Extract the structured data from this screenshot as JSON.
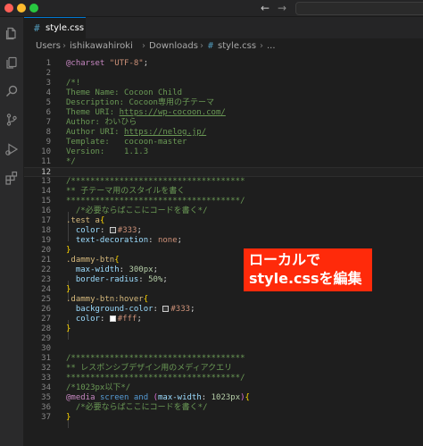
{
  "window": {
    "nav_back": "←",
    "nav_forward": "→"
  },
  "activity_bar": {
    "icons": [
      "explorer-icon",
      "copy-icon",
      "search-icon",
      "source-control-icon",
      "run-debug-icon",
      "extensions-icon"
    ]
  },
  "tab": {
    "icon": "#",
    "label": "style.css",
    "icon_color": "#519aba"
  },
  "breadcrumb": {
    "parts": [
      "Users",
      "ishikawahiroki",
      "Downloads"
    ],
    "file_icon": "#",
    "file": "style.css",
    "trail": "..."
  },
  "editor": {
    "current_line": 12,
    "lines": [
      {
        "n": "1",
        "tokens": [
          {
            "t": "@charset",
            "c": "at"
          },
          {
            "t": " "
          },
          {
            "t": "\"UTF-8\"",
            "c": "str"
          },
          {
            "t": ";",
            "c": "punc"
          }
        ]
      },
      {
        "n": "2",
        "tokens": []
      },
      {
        "n": "3",
        "tokens": [
          {
            "t": "/*!",
            "c": "com"
          }
        ]
      },
      {
        "n": "4",
        "tokens": [
          {
            "t": "Theme Name: Cocoon Child",
            "c": "com"
          }
        ]
      },
      {
        "n": "5",
        "tokens": [
          {
            "t": "Description: Cocoon専用の子テーマ",
            "c": "com"
          }
        ]
      },
      {
        "n": "6",
        "tokens": [
          {
            "t": "Theme URI: ",
            "c": "com"
          },
          {
            "t": "https://wp-cocoon.com/",
            "c": "link"
          }
        ]
      },
      {
        "n": "7",
        "tokens": [
          {
            "t": "Author: わいひら",
            "c": "com"
          }
        ]
      },
      {
        "n": "8",
        "tokens": [
          {
            "t": "Author URI: ",
            "c": "com"
          },
          {
            "t": "https://nelog.jp/",
            "c": "link"
          }
        ]
      },
      {
        "n": "9",
        "tokens": [
          {
            "t": "Template:   cocoon-master",
            "c": "com"
          }
        ]
      },
      {
        "n": "10",
        "tokens": [
          {
            "t": "Version:    1.1.3",
            "c": "com"
          }
        ]
      },
      {
        "n": "11",
        "tokens": [
          {
            "t": "*/",
            "c": "com"
          }
        ]
      },
      {
        "n": "12",
        "tokens": []
      },
      {
        "n": "13",
        "tokens": [
          {
            "t": "/************************************",
            "c": "com"
          }
        ]
      },
      {
        "n": "14",
        "tokens": [
          {
            "t": "** 子テーマ用のスタイルを書く",
            "c": "com"
          }
        ]
      },
      {
        "n": "15",
        "tokens": [
          {
            "t": "************************************/",
            "c": "com"
          }
        ]
      },
      {
        "n": "16",
        "tokens": [
          {
            "t": "  "
          },
          {
            "t": "/*必要ならばここにコードを書く*/",
            "c": "com"
          }
        ]
      },
      {
        "n": "17",
        "tokens": [
          {
            "t": ".test a",
            "c": "sel"
          },
          {
            "t": "{",
            "c": "brace"
          }
        ]
      },
      {
        "n": "18",
        "tokens": [
          {
            "t": "  "
          },
          {
            "t": "color",
            "c": "prop"
          },
          {
            "t": ": ",
            "c": "punc"
          },
          {
            "sw": "#333333"
          },
          {
            "t": "#333",
            "c": "val"
          },
          {
            "t": ";",
            "c": "punc"
          }
        ]
      },
      {
        "n": "19",
        "tokens": [
          {
            "t": "  "
          },
          {
            "t": "text-decoration",
            "c": "prop"
          },
          {
            "t": ": ",
            "c": "punc"
          },
          {
            "t": "none",
            "c": "val"
          },
          {
            "t": ";",
            "c": "punc"
          }
        ]
      },
      {
        "n": "20",
        "tokens": [
          {
            "t": "}",
            "c": "brace"
          }
        ]
      },
      {
        "n": "21",
        "tokens": [
          {
            "t": ".dammy-btn",
            "c": "sel"
          },
          {
            "t": "{",
            "c": "brace"
          }
        ]
      },
      {
        "n": "22",
        "tokens": [
          {
            "t": "  "
          },
          {
            "t": "max-width",
            "c": "prop"
          },
          {
            "t": ": ",
            "c": "punc"
          },
          {
            "t": "300px",
            "c": "num"
          },
          {
            "t": ";",
            "c": "punc"
          }
        ]
      },
      {
        "n": "23",
        "tokens": [
          {
            "t": "  "
          },
          {
            "t": "border-radius",
            "c": "prop"
          },
          {
            "t": ": ",
            "c": "punc"
          },
          {
            "t": "50%",
            "c": "num"
          },
          {
            "t": ";",
            "c": "punc"
          }
        ]
      },
      {
        "n": "24",
        "tokens": [
          {
            "t": "}",
            "c": "brace"
          }
        ]
      },
      {
        "n": "25",
        "tokens": [
          {
            "t": ".dammy-btn:hover",
            "c": "sel"
          },
          {
            "t": "{",
            "c": "brace"
          }
        ]
      },
      {
        "n": "26",
        "tokens": [
          {
            "t": "  "
          },
          {
            "t": "background-color",
            "c": "prop"
          },
          {
            "t": ": ",
            "c": "punc"
          },
          {
            "sw": "#333333"
          },
          {
            "t": "#333",
            "c": "val"
          },
          {
            "t": ";",
            "c": "punc"
          }
        ]
      },
      {
        "n": "27",
        "tokens": [
          {
            "t": "  "
          },
          {
            "t": "color",
            "c": "prop"
          },
          {
            "t": ": ",
            "c": "punc"
          },
          {
            "sw": "#ffffff"
          },
          {
            "t": "#fff",
            "c": "val"
          },
          {
            "t": ";",
            "c": "punc"
          }
        ]
      },
      {
        "n": "28",
        "tokens": [
          {
            "t": "}",
            "c": "brace"
          }
        ]
      },
      {
        "n": "29",
        "tokens": []
      },
      {
        "n": "30",
        "tokens": []
      },
      {
        "n": "31",
        "tokens": [
          {
            "t": "/************************************",
            "c": "com"
          }
        ]
      },
      {
        "n": "32",
        "tokens": [
          {
            "t": "** レスポンシブデザイン用のメディアクエリ",
            "c": "com"
          }
        ]
      },
      {
        "n": "33",
        "tokens": [
          {
            "t": "************************************/",
            "c": "com"
          }
        ]
      },
      {
        "n": "34",
        "tokens": [
          {
            "t": "/*1023px以下*/",
            "c": "com"
          }
        ]
      },
      {
        "n": "35",
        "tokens": [
          {
            "t": "@media",
            "c": "at"
          },
          {
            "t": " "
          },
          {
            "t": "screen",
            "c": "kw"
          },
          {
            "t": " "
          },
          {
            "t": "and",
            "c": "kw"
          },
          {
            "t": " "
          },
          {
            "t": "(",
            "c": "paren"
          },
          {
            "t": "max-width",
            "c": "prop"
          },
          {
            "t": ": ",
            "c": "punc"
          },
          {
            "t": "1023px",
            "c": "num"
          },
          {
            "t": ")",
            "c": "paren"
          },
          {
            "t": "{",
            "c": "brace"
          }
        ]
      },
      {
        "n": "36",
        "tokens": [
          {
            "t": "  "
          },
          {
            "t": "/*必要ならばここにコードを書く*/",
            "c": "com"
          }
        ]
      },
      {
        "n": "37",
        "tokens": [
          {
            "t": "}",
            "c": "brace"
          }
        ]
      }
    ]
  },
  "callout": {
    "line1": "ローカルで",
    "line2": "style.cssを編集",
    "background": "#ff2a0a"
  }
}
